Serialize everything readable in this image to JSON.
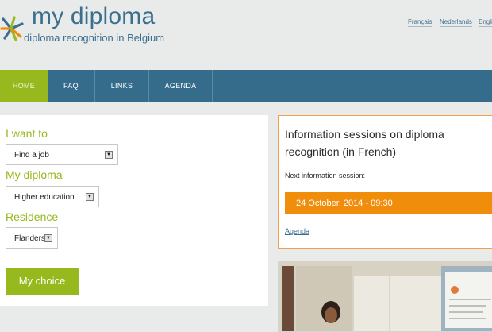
{
  "header": {
    "logo_title": "my diploma",
    "logo_subtitle": "diploma recognition in Belgium",
    "languages": [
      "Français",
      "Nederlands",
      "Engli"
    ]
  },
  "nav": {
    "items": [
      "HOME",
      "FAQ",
      "LINKS",
      "AGENDA"
    ],
    "active": "HOME"
  },
  "form": {
    "want_label": "I want to",
    "want_value": "Find a job",
    "diploma_label": "My diploma",
    "diploma_value": "Higher education",
    "residence_label": "Residence",
    "residence_value": "Flanders",
    "submit_label": "My choice"
  },
  "info": {
    "title": "Information sessions on diploma recognition (in French)",
    "next_label": "Next information session:",
    "date": "24 October, 2014 - 09:30",
    "link": "Agenda"
  },
  "colors": {
    "brand_blue": "#356c8c",
    "accent_green": "#97b91e",
    "accent_orange": "#f08d0b"
  },
  "icons": {
    "logo": "star-burst-logo-icon",
    "select_arrow": "dropdown-arrow-icon"
  }
}
